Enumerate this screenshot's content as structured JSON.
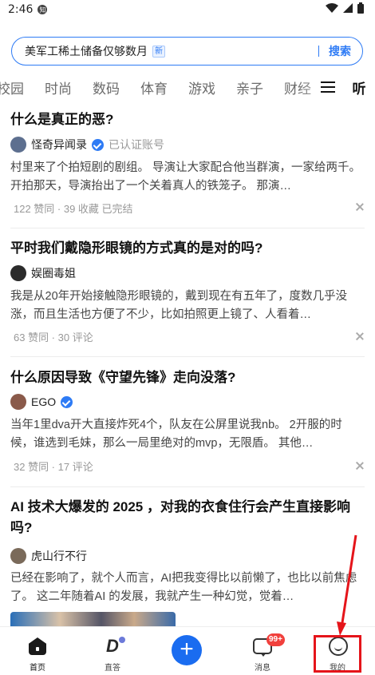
{
  "status": {
    "time": "2:46",
    "notification": "知"
  },
  "search": {
    "query": "美军工稀土储备仅够数月",
    "tag": "新",
    "button": "搜索"
  },
  "tabs": [
    "校园",
    "时尚",
    "数码",
    "体育",
    "游戏",
    "亲子",
    "财经"
  ],
  "tabs_right": "听",
  "cards": [
    {
      "title": "什么是真正的恶?",
      "author": "怪奇异闻录",
      "verified_text": "已认证账号",
      "excerpt": "村里来了个拍短剧的剧组。 导演让大家配合他当群演，一家给两千。 开拍那天，导演抬出了一个关着真人的铁笼子。 那演…",
      "meta": "122 赞同 · 39 收藏  已完结"
    },
    {
      "title": "平时我们戴隐形眼镜的方式真的是对的吗?",
      "author": "娱圈毒姐",
      "excerpt": "我是从20年开始接触隐形眼镜的，戴到现在有五年了，度数几乎没涨，而且生活也方便了不少，比如拍照更上镜了、人看着…",
      "meta": "63 赞同 · 30 评论"
    },
    {
      "title": "什么原因导致《守望先锋》走向没落?",
      "author": "EGO",
      "excerpt": "当年1里dva开大直接炸死4个，队友在公屏里说我nb。 2开服的时候，谁选到毛妹，那么一局里绝对的mvp，无限盾。 其他…",
      "meta": "32 赞同 · 17 评论"
    },
    {
      "title": "AI 技术大爆发的 2025 ，对我的衣食住行会产生直接影响吗?",
      "author": "虎山行不行",
      "excerpt": "已经在影响了，就个人而言，AI把我变得比以前懒了，也比以前焦虑了。 这二年随着AI 的发展，我就产生一种幻觉，觉着…"
    }
  ],
  "bottom_nav": [
    {
      "label": "首页"
    },
    {
      "label": "直答"
    },
    {
      "label": ""
    },
    {
      "label": "消息",
      "badge": "99+"
    },
    {
      "label": "我的"
    }
  ]
}
